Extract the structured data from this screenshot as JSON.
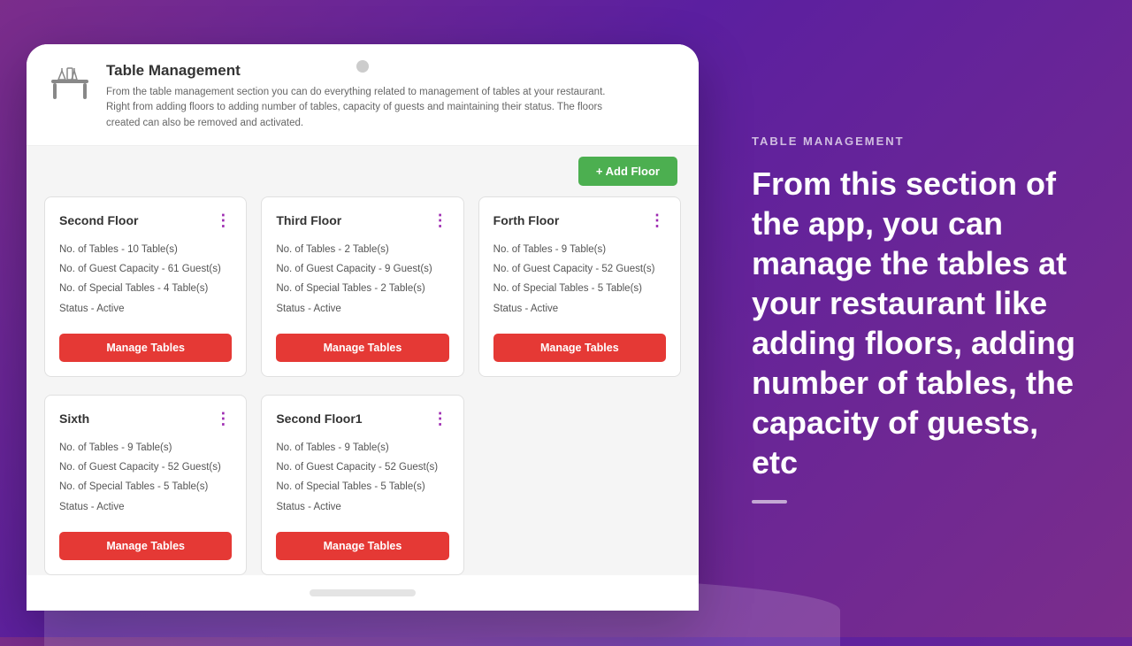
{
  "right_panel": {
    "section_label": "TABLE MANAGEMENT",
    "main_text": "From this section of the app, you can manage the tables at your restaurant like adding floors, adding number of tables, the capacity of guests, etc"
  },
  "app_header": {
    "title": "Table Management",
    "description": "From the table management section you can do everything related to management of tables at your restaurant. Right from adding floors to adding number of tables, capacity of guests and maintaining their status. The floors created can also be removed and activated."
  },
  "toolbar": {
    "add_floor_label": "+ Add Floor"
  },
  "floors": [
    {
      "name": "Second Floor",
      "tables": "10 Table(s)",
      "guest_capacity": "61 Guest(s)",
      "special_tables": "4 Table(s)",
      "status": "Active",
      "btn_label": "Manage Tables"
    },
    {
      "name": "Third Floor",
      "tables": "2 Table(s)",
      "guest_capacity": "9 Guest(s)",
      "special_tables": "2 Table(s)",
      "status": "Active",
      "btn_label": "Manage Tables"
    },
    {
      "name": "Forth Floor",
      "tables": "9 Table(s)",
      "guest_capacity": "52 Guest(s)",
      "special_tables": "5 Table(s)",
      "status": "Active",
      "btn_label": "Manage Tables"
    },
    {
      "name": "Sixth",
      "tables": "9 Table(s)",
      "guest_capacity": "52 Guest(s)",
      "special_tables": "5 Table(s)",
      "status": "Active",
      "btn_label": "Manage Tables"
    },
    {
      "name": "Second Floor1",
      "tables": "9 Table(s)",
      "guest_capacity": "52 Guest(s)",
      "special_tables": "5 Table(s)",
      "status": "Active",
      "btn_label": "Manage Tables"
    }
  ],
  "labels": {
    "no_of_tables": "No. of Tables - ",
    "no_of_guest_capacity": "No. of Guest Capacity - ",
    "no_of_special_tables": "No. of Special Tables - ",
    "status": "Status - "
  },
  "colors": {
    "manage_btn": "#e53935",
    "add_floor_btn": "#4caf50",
    "more_icon": "#9c27b0"
  }
}
